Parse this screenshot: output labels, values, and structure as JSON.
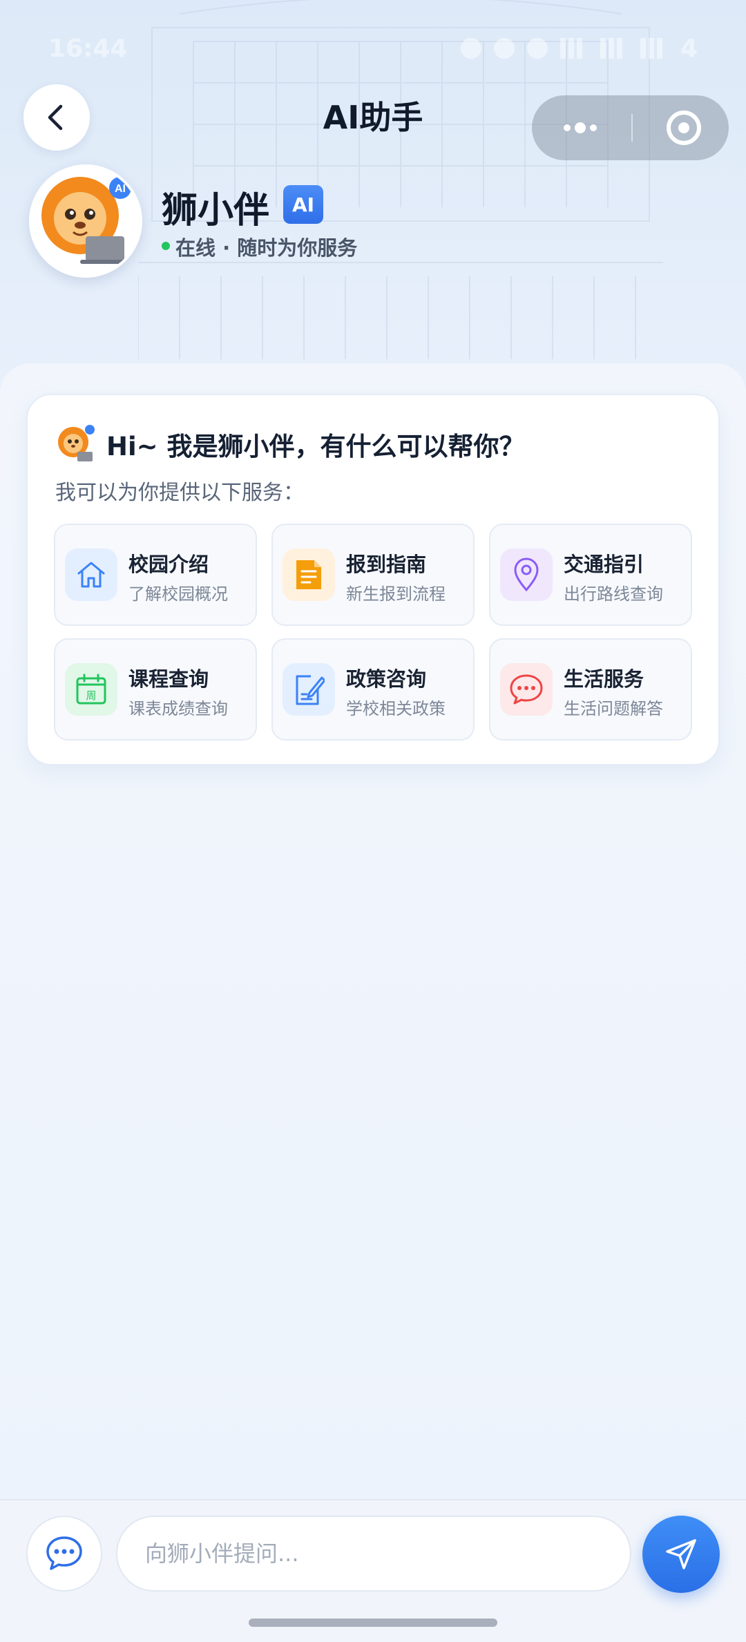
{
  "status_bar": {
    "time": "16:44",
    "battery": "4"
  },
  "header": {
    "title": "AI助手"
  },
  "bot": {
    "name": "狮小伴",
    "badge": "AI",
    "status": "在线 · 随时为你服务",
    "status_color": "#22c55e",
    "avatar_badge": "AI"
  },
  "welcome": {
    "title": "Hi~ 我是狮小伴，有什么可以帮你？",
    "subtitle": "我可以为你提供以下服务："
  },
  "services": [
    {
      "title": "校园介绍",
      "desc": "了解校园概况",
      "icon": "home-icon",
      "color": "#3b82f6"
    },
    {
      "title": "报到指南",
      "desc": "新生报到流程",
      "icon": "document-icon",
      "color": "#f59e0b"
    },
    {
      "title": "交通指引",
      "desc": "出行路线查询",
      "icon": "location-pin-icon",
      "color": "#8b5cf6"
    },
    {
      "title": "课程查询",
      "desc": "课表成绩查询",
      "icon": "calendar-icon",
      "color": "#22c55e",
      "icon_text": "周"
    },
    {
      "title": "政策咨询",
      "desc": "学校相关政策",
      "icon": "edit-document-icon",
      "color": "#3b82f6"
    },
    {
      "title": "生活服务",
      "desc": "生活问题解答",
      "icon": "chat-bubble-icon",
      "color": "#ef4444"
    }
  ],
  "input": {
    "placeholder": "向狮小伴提问..."
  },
  "colors": {
    "accent": "#2f6ee8",
    "background": "#eaf1fb"
  }
}
